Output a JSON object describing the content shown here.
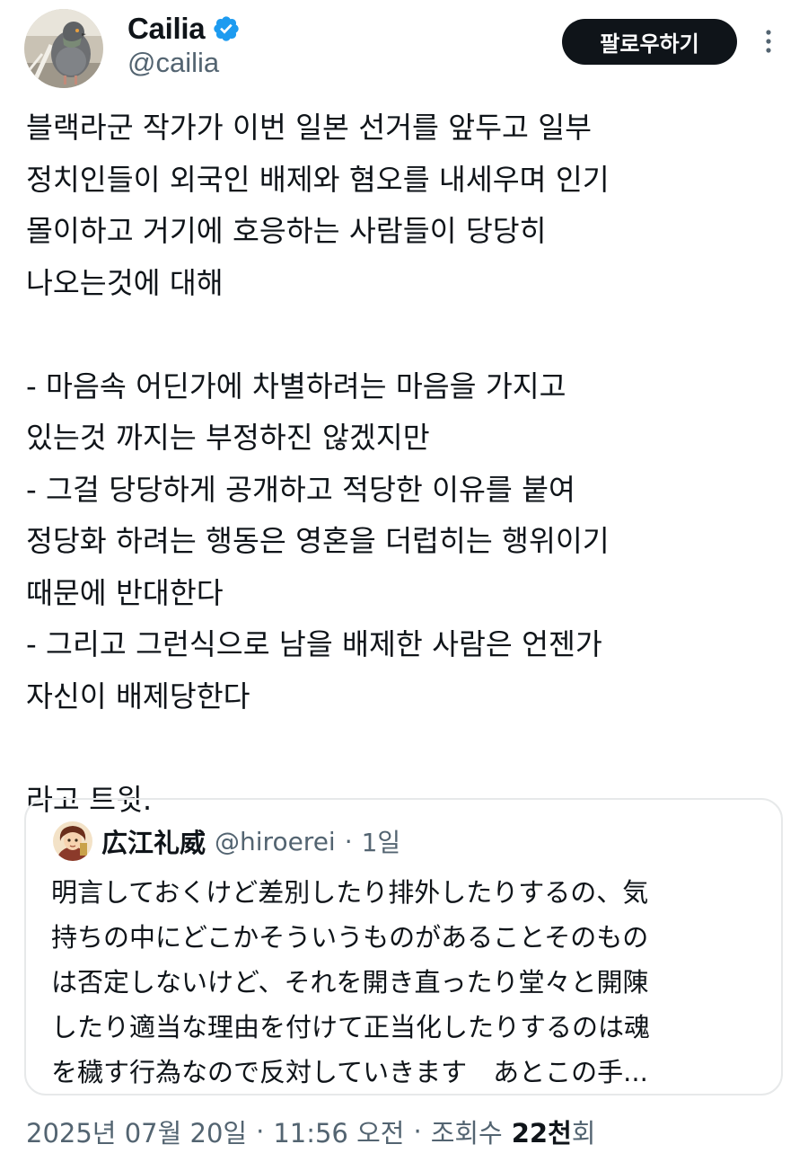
{
  "author": {
    "display_name": "Cailia",
    "handle": "@cailia",
    "verified": true,
    "avatar_icon": "pigeon-avatar"
  },
  "actions": {
    "follow_label": "팔로우하기",
    "more_icon": "more-vertical-icon"
  },
  "tweet": {
    "lines": [
      "블랙라군 작가가 이번 일본 선거를 앞두고 일부",
      "정치인들이 외국인 배제와 혐오를 내세우며 인기",
      "몰이하고 거기에 호응하는 사람들이 당당히",
      "나오는것에 대해",
      "",
      "- 마음속 어딘가에 차별하려는 마음을 가지고",
      "있는것 까지는 부정하진 않겠지만",
      "- 그걸 당당하게 공개하고 적당한 이유를 붙여",
      "정당화 하려는 행동은 영혼을 더럽히는 행위이기",
      "때문에 반대한다",
      "- 그리고 그런식으로 남을 배제한 사람은 언젠가",
      "자신이 배제당한다",
      "",
      "라고 트윗."
    ]
  },
  "quote": {
    "display_name": "広江礼威",
    "handle": "@hiroerei",
    "separator": "·",
    "time": "1일",
    "avatar_icon": "illustrated-character-avatar",
    "lines": [
      "明言しておくけど差別したり排外したりするの、気",
      "持ちの中にどこかそういうものがあることそのもの",
      "は否定しないけど、それを開き直ったり堂々と開陳",
      "したり適当な理由を付けて正当化したりするのは魂",
      "を穢す行為なので反対していきます　あとこの手..."
    ]
  },
  "meta": {
    "date": "2025년 07월 20일",
    "separator": "·",
    "time": "11:56 오전",
    "views_label": "조회수",
    "views_count": "22천",
    "views_suffix": "회"
  },
  "colors": {
    "text_primary": "#0f1419",
    "text_secondary": "#536471",
    "verified_blue": "#1d9bf0",
    "follow_bg": "#0f1419",
    "border": "#e7e9ea"
  }
}
